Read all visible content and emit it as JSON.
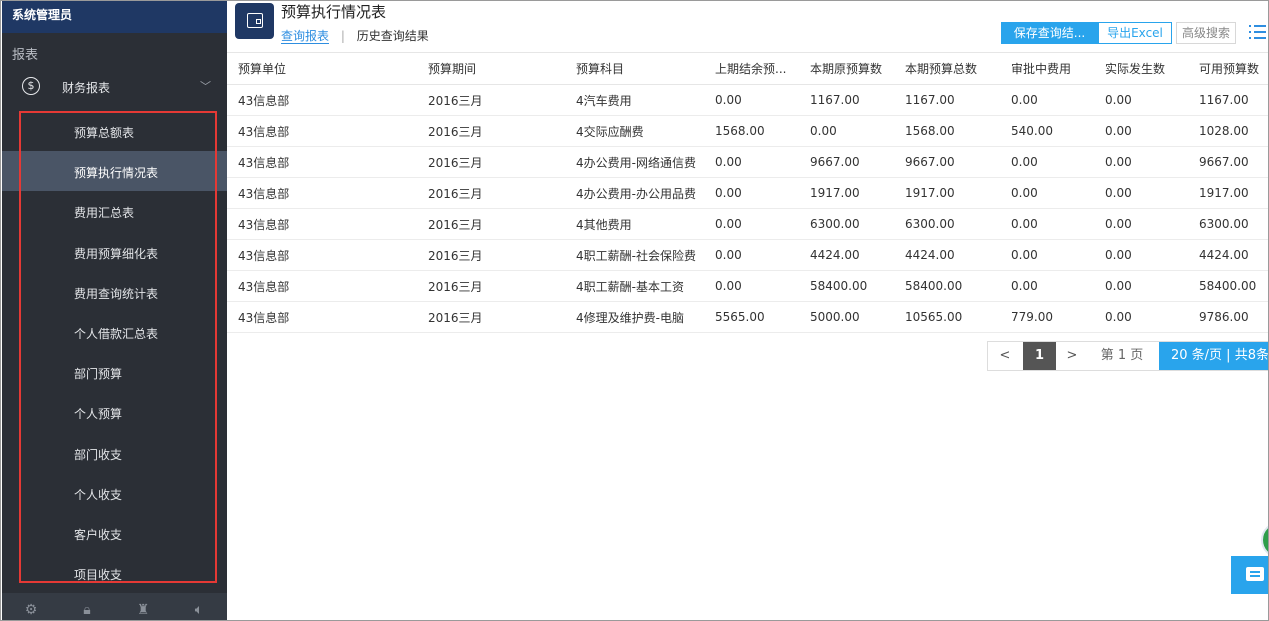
{
  "sidebar": {
    "user": "系统管理员",
    "section": "报表",
    "group": {
      "label": "财务报表",
      "icon": "dollar-circle-icon"
    },
    "items": [
      {
        "label": "预算总额表",
        "active": false
      },
      {
        "label": "预算执行情况表",
        "active": true
      },
      {
        "label": "费用汇总表",
        "active": false
      },
      {
        "label": "费用预算细化表",
        "active": false
      },
      {
        "label": "费用查询统计表",
        "active": false
      },
      {
        "label": "个人借款汇总表",
        "active": false
      },
      {
        "label": "部门预算",
        "active": false
      },
      {
        "label": "个人预算",
        "active": false
      },
      {
        "label": "部门收支",
        "active": false
      },
      {
        "label": "个人收支",
        "active": false
      },
      {
        "label": "客户收支",
        "active": false
      },
      {
        "label": "项目收支",
        "active": false
      }
    ],
    "bottom_icons": [
      "settings-icon",
      "lock-icon",
      "shirt-icon",
      "speaker-icon"
    ]
  },
  "header": {
    "title": "预算执行情况表",
    "tabs": [
      {
        "label": "查询报表",
        "active": true
      },
      {
        "label": "历史查询结果",
        "active": false
      }
    ],
    "buttons": {
      "save": "保存查询结...",
      "export": "导出Excel",
      "advanced": "高级搜索"
    }
  },
  "table": {
    "columns": [
      "预算单位",
      "预算期间",
      "预算科目",
      "上期结余预...",
      "本期原预算数",
      "本期预算总数",
      "审批中费用",
      "实际发生数",
      "可用预算数"
    ],
    "rows": [
      [
        "43信息部",
        "2016三月",
        "4汽车费用",
        "0.00",
        "1167.00",
        "1167.00",
        "0.00",
        "0.00",
        "1167.00"
      ],
      [
        "43信息部",
        "2016三月",
        "4交际应酬费",
        "1568.00",
        "0.00",
        "1568.00",
        "540.00",
        "0.00",
        "1028.00"
      ],
      [
        "43信息部",
        "2016三月",
        "4办公费用-网络通信费",
        "0.00",
        "9667.00",
        "9667.00",
        "0.00",
        "0.00",
        "9667.00"
      ],
      [
        "43信息部",
        "2016三月",
        "4办公费用-办公用品费",
        "0.00",
        "1917.00",
        "1917.00",
        "0.00",
        "0.00",
        "1917.00"
      ],
      [
        "43信息部",
        "2016三月",
        "4其他费用",
        "0.00",
        "6300.00",
        "6300.00",
        "0.00",
        "0.00",
        "6300.00"
      ],
      [
        "43信息部",
        "2016三月",
        "4职工薪酬-社会保险费",
        "0.00",
        "4424.00",
        "4424.00",
        "0.00",
        "0.00",
        "4424.00"
      ],
      [
        "43信息部",
        "2016三月",
        "4职工薪酬-基本工资",
        "0.00",
        "58400.00",
        "58400.00",
        "0.00",
        "0.00",
        "58400.00"
      ],
      [
        "43信息部",
        "2016三月",
        "4修理及维护费-电脑",
        "5565.00",
        "5000.00",
        "10565.00",
        "779.00",
        "0.00",
        "9786.00"
      ]
    ]
  },
  "pager": {
    "prev": "<",
    "current": "1",
    "next": ">",
    "jump": "第  1  页",
    "size": "20  条/页 | 共8条"
  },
  "colors": {
    "accent": "#29a4ec",
    "sidebar_bg": "#2b2f36",
    "header_dark": "#1f3864",
    "highlight_box": "#e53935"
  }
}
